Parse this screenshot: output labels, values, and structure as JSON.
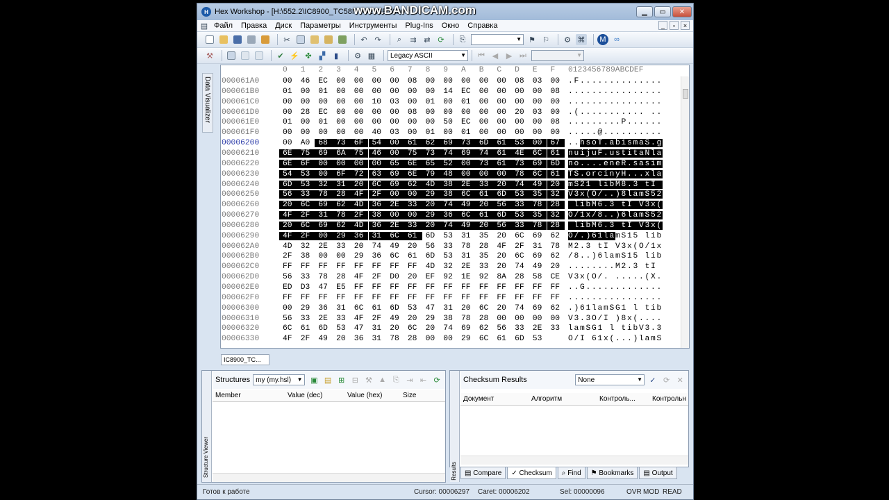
{
  "watermark": "www.BANDICAM.com",
  "window": {
    "title": "Hex Workshop - [H:\\552.2\\IC8900_TC58NVG2S3ETA00.nt..."
  },
  "menu": [
    "Файл",
    "Правка",
    "Диск",
    "Параметры",
    "Инструменты",
    "Plug-Ins",
    "Окно",
    "Справка"
  ],
  "toolbar": {
    "encoding": "Legacy ASCII"
  },
  "data_visualizer": "Data Visualizer",
  "hex": {
    "header_bytes": [
      "0",
      "1",
      "2",
      "3",
      "4",
      "5",
      "6",
      "7",
      "8",
      "9",
      "A",
      "B",
      "C",
      "D",
      "E",
      "F"
    ],
    "header_ascii": "0123456789ABCDEF",
    "rows": [
      {
        "o": "000061A0",
        "h": [
          "00",
          "46",
          "EC",
          "00",
          "00",
          "00",
          "00",
          "08",
          "00",
          "00",
          "00",
          "00",
          "00",
          "08",
          "03",
          "00"
        ],
        "a": ".F.............."
      },
      {
        "o": "000061B0",
        "h": [
          "01",
          "00",
          "01",
          "00",
          "00",
          "00",
          "00",
          "00",
          "00",
          "14",
          "EC",
          "00",
          "00",
          "00",
          "00",
          "08"
        ],
        "a": "................"
      },
      {
        "o": "000061C0",
        "h": [
          "00",
          "00",
          "00",
          "00",
          "00",
          "10",
          "03",
          "00",
          "01",
          "00",
          "01",
          "00",
          "00",
          "00",
          "00",
          "00"
        ],
        "a": "................"
      },
      {
        "o": "000061D0",
        "h": [
          "00",
          "28",
          "EC",
          "00",
          "00",
          "00",
          "00",
          "08",
          "00",
          "00",
          "00",
          "00",
          "00",
          "20",
          "03",
          "00"
        ],
        "a": ".(........... .."
      },
      {
        "o": "000061E0",
        "h": [
          "01",
          "00",
          "01",
          "00",
          "00",
          "00",
          "00",
          "00",
          "00",
          "50",
          "EC",
          "00",
          "00",
          "00",
          "00",
          "08"
        ],
        "a": ".........P......"
      },
      {
        "o": "000061F0",
        "h": [
          "00",
          "00",
          "00",
          "00",
          "00",
          "40",
          "03",
          "00",
          "01",
          "00",
          "01",
          "00",
          "00",
          "00",
          "00",
          "00"
        ],
        "a": ".....@.........."
      },
      {
        "o": "00006200",
        "h": [
          "00",
          "A0",
          "68",
          "73",
          "6F",
          "54",
          "00",
          "61",
          "62",
          "69",
          "73",
          "6D",
          "61",
          "53",
          "00",
          "67"
        ],
        "a": "..hsoT.abismaS.g"
      },
      {
        "o": "00006210",
        "h": [
          "6E",
          "75",
          "69",
          "6A",
          "75",
          "46",
          "00",
          "75",
          "73",
          "74",
          "69",
          "74",
          "61",
          "4E",
          "6C",
          "61"
        ],
        "a": "nuijuF.ustitaNla"
      },
      {
        "o": "00006220",
        "h": [
          "6E",
          "6F",
          "00",
          "00",
          "00",
          "00",
          "65",
          "6E",
          "65",
          "52",
          "00",
          "73",
          "61",
          "73",
          "69",
          "6D"
        ],
        "a": "no....eneR.sasim"
      },
      {
        "o": "00006230",
        "h": [
          "54",
          "53",
          "00",
          "6F",
          "72",
          "63",
          "69",
          "6E",
          "79",
          "48",
          "00",
          "00",
          "00",
          "78",
          "6C",
          "61"
        ],
        "a": "TS.orcinyH...xla"
      },
      {
        "o": "00006240",
        "h": [
          "6D",
          "53",
          "32",
          "31",
          "20",
          "6C",
          "69",
          "62",
          "4D",
          "38",
          "2E",
          "33",
          "20",
          "74",
          "49",
          "20"
        ],
        "a": "mS21 libM8.3 tI "
      },
      {
        "o": "00006250",
        "h": [
          "56",
          "33",
          "78",
          "28",
          "4F",
          "2F",
          "00",
          "00",
          "29",
          "38",
          "6C",
          "61",
          "6D",
          "53",
          "35",
          "32"
        ],
        "a": "V3x(O/..)8lamS52"
      },
      {
        "o": "00006260",
        "h": [
          "20",
          "6C",
          "69",
          "62",
          "4D",
          "36",
          "2E",
          "33",
          "20",
          "74",
          "49",
          "20",
          "56",
          "33",
          "78",
          "28"
        ],
        "a": " libM6.3 tI V3x("
      },
      {
        "o": "00006270",
        "h": [
          "4F",
          "2F",
          "31",
          "78",
          "2F",
          "38",
          "00",
          "00",
          "29",
          "36",
          "6C",
          "61",
          "6D",
          "53",
          "35",
          "32"
        ],
        "a": "O/1x/8..)6lamS52"
      },
      {
        "o": "00006280",
        "h": [
          "20",
          "6C",
          "69",
          "62",
          "4D",
          "36",
          "2E",
          "33",
          "20",
          "74",
          "49",
          "20",
          "56",
          "33",
          "78",
          "28"
        ],
        "a": " libM6.3 tI V3x("
      },
      {
        "o": "00006290",
        "h": [
          "4F",
          "2F",
          "00",
          "29",
          "36",
          "31",
          "6C",
          "61",
          "6D",
          "53",
          "31",
          "35",
          "20",
          "6C",
          "69",
          "62"
        ],
        "a": "O/.)61lamS15 lib"
      },
      {
        "o": "000062A0",
        "h": [
          "4D",
          "32",
          "2E",
          "33",
          "20",
          "74",
          "49",
          "20",
          "56",
          "33",
          "78",
          "28",
          "4F",
          "2F",
          "31",
          "78"
        ],
        "a": "M2.3 tI V3x(O/1x"
      },
      {
        "o": "000062B0",
        "h": [
          "2F",
          "38",
          "00",
          "00",
          "29",
          "36",
          "6C",
          "61",
          "6D",
          "53",
          "31",
          "35",
          "20",
          "6C",
          "69",
          "62"
        ],
        "a": "/8..)6lamS15 lib"
      },
      {
        "o": "000062C0",
        "h": [
          "FF",
          "FF",
          "FF",
          "FF",
          "FF",
          "FF",
          "FF",
          "FF",
          "4D",
          "32",
          "2E",
          "33",
          "20",
          "74",
          "49",
          "20"
        ],
        "a": "........M2.3 tI "
      },
      {
        "o": "000062D0",
        "h": [
          "56",
          "33",
          "78",
          "28",
          "4F",
          "2F",
          "D0",
          "20",
          "EF",
          "92",
          "1E",
          "92",
          "8A",
          "28",
          "58",
          "CE"
        ],
        "a": "V3x(O/. .....(X."
      },
      {
        "o": "000062E0",
        "h": [
          "ED",
          "D3",
          "47",
          "E5",
          "FF",
          "FF",
          "FF",
          "FF",
          "FF",
          "FF",
          "FF",
          "FF",
          "FF",
          "FF",
          "FF",
          "FF"
        ],
        "a": "..G............."
      },
      {
        "o": "000062F0",
        "h": [
          "FF",
          "FF",
          "FF",
          "FF",
          "FF",
          "FF",
          "FF",
          "FF",
          "FF",
          "FF",
          "FF",
          "FF",
          "FF",
          "FF",
          "FF",
          "FF"
        ],
        "a": "................"
      },
      {
        "o": "00006300",
        "h": [
          "00",
          "29",
          "36",
          "31",
          "6C",
          "61",
          "6D",
          "53",
          "47",
          "31",
          "20",
          "6C",
          "20",
          "74",
          "69",
          "62"
        ],
        "a": ".)61lamSG1 l tib"
      },
      {
        "o": "00006310",
        "h": [
          "56",
          "33",
          "2E",
          "33",
          "4F",
          "2F",
          "49",
          "20",
          "29",
          "38",
          "78",
          "28",
          "00",
          "00",
          "00",
          "00"
        ],
        "a": "V3.3O/I )8x(...."
      },
      {
        "o": "00006320",
        "h": [
          "6C",
          "61",
          "6D",
          "53",
          "47",
          "31",
          "20",
          "6C",
          "20",
          "74",
          "69",
          "62",
          "56",
          "33",
          "2E",
          "33"
        ],
        "a": "lamSG1 l tibV3.3"
      },
      {
        "o": "00006330",
        "h": [
          "4F",
          "2F",
          "49",
          "20",
          "36",
          "31",
          "78",
          "28",
          "00",
          "00",
          "29",
          "6C",
          "61",
          "6D",
          "53"
        ],
        "a": "O/I 61x(...)lamS"
      }
    ]
  },
  "file_tab": "IC8900_TC...",
  "structures": {
    "label": "Structures",
    "library": "my (my.hsl)",
    "side_label": "Structure Viewer",
    "columns": [
      "Member",
      "Value (dec)",
      "Value (hex)",
      "Size"
    ]
  },
  "checksum": {
    "title": "Checksum Results",
    "algorithm": "None",
    "side_label": "Results",
    "columns": [
      "Документ",
      "Алгоритм",
      "Контроль...",
      "Контрольн"
    ]
  },
  "result_tabs": [
    "Compare",
    "Checksum",
    "Find",
    "Bookmarks",
    "Output"
  ],
  "status": {
    "ready": "Готов к работе",
    "cursor": "Cursor: 00006297",
    "caret": "Caret: 00006202",
    "sel": "Sel: 00000096",
    "ovr": "OVR",
    "mod": "MOD",
    "read": "READ"
  }
}
